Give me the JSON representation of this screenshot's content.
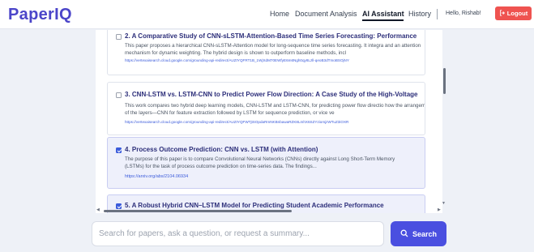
{
  "app": {
    "logo": "PaperIQ"
  },
  "nav": {
    "home": "Home",
    "document_analysis": "Document Analysis",
    "ai_assistant": "AI Assistant",
    "history": "History",
    "greeting": "Hello, Rishab!",
    "logout": "Logout"
  },
  "results": [
    {
      "checked": false,
      "title": "2. A Comparative Study of CNN-sLSTM-Attention-Based Time Series Forecasting: Performance",
      "description": "This paper proposes a hierarchical CNN-sLSTM-Attention model for long-sequence time series forecasting. It integra and an attention mechanism for dynamic weighting. The hybrid design is shown to outperform baseline methods, incl",
      "link": "https://vertexaisearch.cloud.google.com/grounding-api-redirect/AUZIYQFRT1B_1WjXdM70EWfyE6m6Ngh0qy8Lzll-qeoB3dTmoBSOjNY"
    },
    {
      "checked": false,
      "title": "3. CNN-LSTM vs. LSTM-CNN to Predict Power Flow Direction: A Case Study of the High-Voltage",
      "description": "This work compares two hybrid deep learning models, CNN-LSTM and LSTM-CNN, for predicting power flow directio how the arrangement of the layers—CNN for feature extraction followed by LSTM for sequence prediction, or vice ve",
      "link": "https://vertexaisearch.cloud.google.com/grounding-api-redirect/AUZIYQFWTjtSOpdaRmNKBnbawaRZK8LmhX6SZYziomjzWTuZ3iOXR"
    },
    {
      "checked": true,
      "title": "4. Process Outcome Prediction: CNN vs. LSTM (with Attention)",
      "description": "The purpose of this paper is to compare Convolutional Neural Networks (CNNs) directly against Long Short-Term Memory (LSTMs) for the task of process outcome prediction on time-series data. The findings...",
      "link": "https://arxiv.org/abs/2104.06934"
    },
    {
      "checked": true,
      "title": "5. A Robust Hybrid CNN–LSTM Model for Predicting Student Academic Performance",
      "description": "",
      "link": ""
    }
  ],
  "search": {
    "placeholder": "Search for papers, ask a question, or request a summary...",
    "button": "Search"
  },
  "colors": {
    "brand": "#4b45c9",
    "logout": "#ef5350",
    "search_button": "#4a4fe0",
    "selected_card": "#eef0fb"
  },
  "icons": {
    "logout": "logout-arrow-icon",
    "search": "search-icon"
  }
}
